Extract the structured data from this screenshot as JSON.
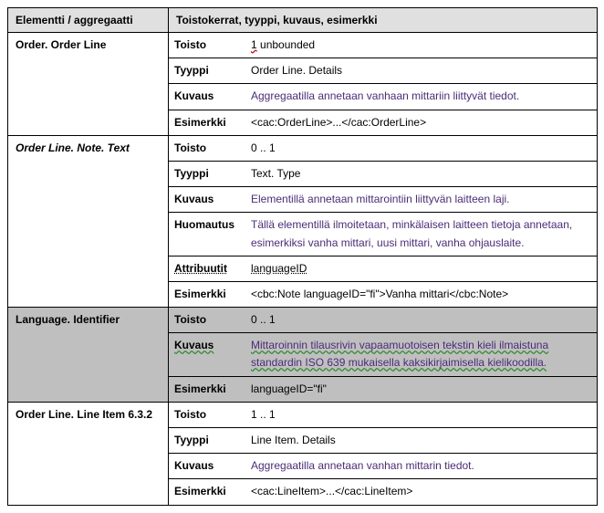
{
  "header": {
    "col1": "Elementti / aggregaatti",
    "col2": "Toistokerrat, tyyppi, kuvaus, esimerkki"
  },
  "labels": {
    "toisto": "Toisto",
    "tyyppi": "Tyyppi",
    "kuvaus": "Kuvaus",
    "huomautus": "Huomautus",
    "attribuutit": "Attribuutit",
    "esimerkki": "Esimerkki"
  },
  "r1": {
    "name": "Order. Order Line",
    "toisto_a": "1",
    "toisto_b": " unbounded",
    "tyyppi": "Order Line. Details",
    "kuvaus": "Aggregaatilla annetaan vanhaan mittariin liittyvät tiedot.",
    "esimerkki": "<cac:OrderLine>...</cac:OrderLine>"
  },
  "r2": {
    "name": "Order Line. Note. Text",
    "toisto": "0 .. 1",
    "tyyppi": "Text. Type",
    "kuvaus": "Elementillä annetaan mittarointiin liittyvän laitteen laji.",
    "huomautus": "Tällä elementillä ilmoitetaan, minkälaisen laitteen tietoja annetaan, esimerkiksi vanha mittari, uusi mittari, vanha ohjauslaite.",
    "attribuutit": "languageID",
    "esimerkki": "<cbc:Note languageID=\"fi\">Vanha mittari</cbc:Note>"
  },
  "r3": {
    "name": "Language. Identifier",
    "toisto": "0 .. 1",
    "kuvaus": "Mittaroinnin tilausrivin vapaamuotoisen tekstin kieli ilmaistuna standardin ISO 639 mukaisella kaksikirjaimisella kielikoodilla.",
    "esimerkki": "languageID=\"fi\""
  },
  "r4": {
    "name": "Order Line. Line Item 6.3.2",
    "toisto": "1 .. 1",
    "tyyppi": "Line Item. Details",
    "kuvaus": "Aggregaatilla annetaan vanhan mittarin tiedot.",
    "esimerkki": "<cac:LineItem>...</cac:LineItem>"
  }
}
